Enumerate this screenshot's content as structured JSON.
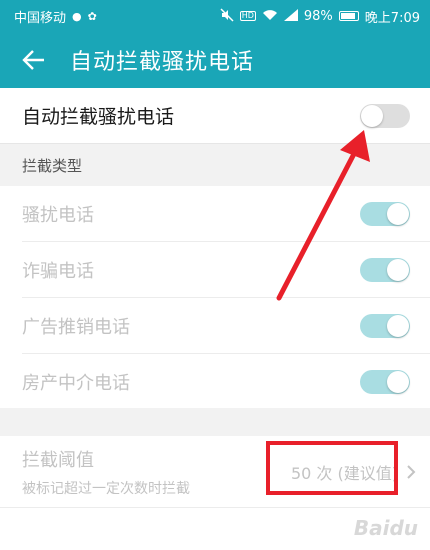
{
  "status_bar": {
    "carrier": "中国移动",
    "battery": "98%",
    "time": "晚上7:09"
  },
  "toolbar": {
    "title": "自动拦截骚扰电话"
  },
  "main_toggle": {
    "label": "自动拦截骚扰电话",
    "state": "off"
  },
  "section": {
    "title": "拦截类型"
  },
  "types": [
    {
      "label": "骚扰电话",
      "state": "on"
    },
    {
      "label": "诈骗电话",
      "state": "on"
    },
    {
      "label": "广告推销电话",
      "state": "on"
    },
    {
      "label": "房产中介电话",
      "state": "on"
    }
  ],
  "threshold": {
    "title": "拦截阈值",
    "subtitle": "被标记超过一定次数时拦截",
    "value": "50 次 (建议值)"
  },
  "watermark": "Baidu",
  "colors": {
    "accent": "#1aa6b7",
    "annotation": "#e8202a"
  }
}
